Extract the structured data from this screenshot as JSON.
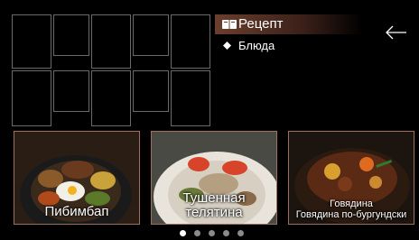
{
  "header": {
    "title": "Рецепт",
    "category": "Блюда",
    "title_icon": "book-icon",
    "category_icon": "diamond-icon",
    "back_icon": "back-arrow-icon",
    "accent": "#6b3e2e"
  },
  "cards": [
    {
      "label": "Пибимбап"
    },
    {
      "label": "Тушенная телятина"
    },
    {
      "label_line1": "Говядина",
      "label_line2": "Говядина по-бургундски"
    }
  ],
  "pagination": {
    "count": 5,
    "active_index": 0
  }
}
